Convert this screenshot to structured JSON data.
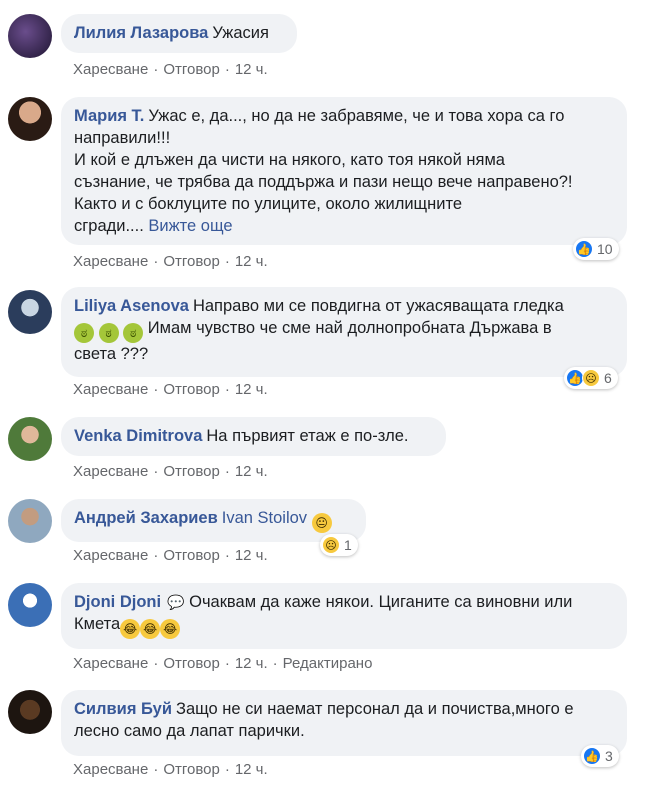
{
  "actions": {
    "like": "Харесване",
    "reply": "Отговор",
    "edited": "Редактирано",
    "dot": "·"
  },
  "comments": [
    {
      "author": "Лилия Лазарова",
      "lines": [
        "Ужасия"
      ],
      "time": "12 ч."
    },
    {
      "author": "Мария Т.",
      "lines": [
        "Ужас е, да..., но да не забравяме, че и това хора са го",
        "направили!!!",
        "И кой е длъжен да чисти на някого, като тоя някой няма",
        "съзнание, че трябва да поддържа и пази нещо вече направено?!",
        "Както и с боклуците по улиците, около жилищните",
        "сгради...."
      ],
      "see_more": "Вижте още",
      "time": "12 ч.",
      "reactions": {
        "count": "10"
      }
    },
    {
      "author": "Liliya Asenova",
      "lines": [
        "Направо ми се повдигна от ужасяващата гледка",
        "Имам чувство че сме най долнопробната Държава в",
        "света ???"
      ],
      "time": "12 ч.",
      "reactions": {
        "count": "6"
      }
    },
    {
      "author": "Venka Dimitrova",
      "lines": [
        "На първият етаж е по-зле."
      ],
      "time": "12 ч."
    },
    {
      "author": "Андрей Захариев",
      "mention": "Ivan Stoilov",
      "time": "12 ч.",
      "reactions": {
        "count": "1"
      }
    },
    {
      "author": "Djoni Djoni",
      "lines": [
        "Очаквам да каже някои. Циганите са виновни или",
        "Кмета"
      ],
      "time": "12 ч."
    },
    {
      "author": "Силвия Буй",
      "lines": [
        "Защо не си наемат персонал да и почиства,много е",
        "лесно само да лапат парички."
      ],
      "time": "12 ч.",
      "reactions": {
        "count": "3"
      }
    }
  ],
  "colors": {
    "link": "#385898",
    "bubble": "#f0f2f5",
    "meta": "#65676b",
    "like": "#1877f2"
  }
}
